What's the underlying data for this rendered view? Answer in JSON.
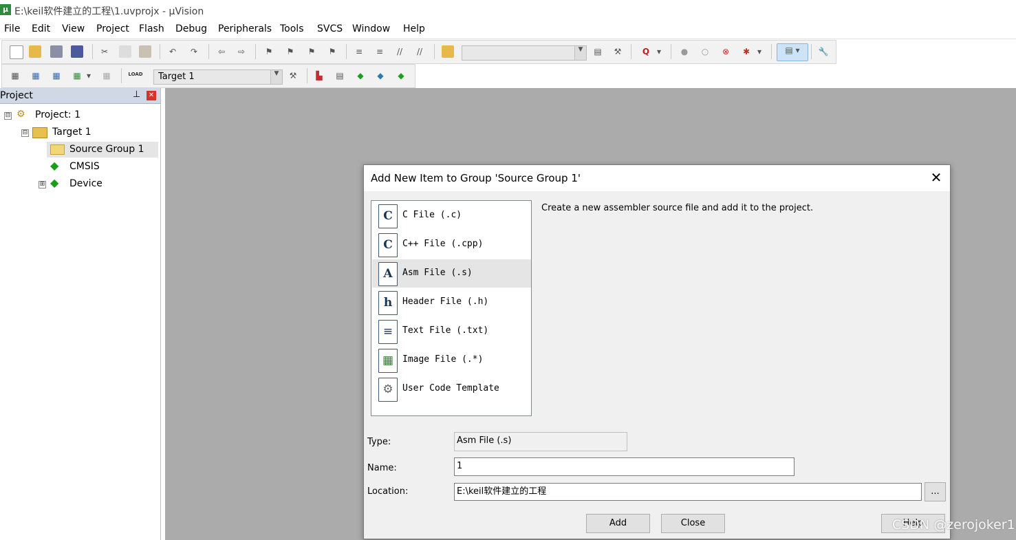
{
  "window": {
    "title": "E:\\keil软件建立的工程\\1.uvprojx - µVision",
    "app_icon": "uvision-icon"
  },
  "menu": [
    "File",
    "Edit",
    "View",
    "Project",
    "Flash",
    "Debug",
    "Peripherals",
    "Tools",
    "SVCS",
    "Window",
    "Help"
  ],
  "toolbar": {
    "target_value": "Target 1",
    "load_label": "LOAD"
  },
  "project_panel": {
    "title": "Project",
    "tree": [
      {
        "label": "Project: 1",
        "expander": "⊟"
      },
      {
        "label": "Target 1",
        "expander": "⊟"
      },
      {
        "label": "Source Group 1",
        "expander": ""
      },
      {
        "label": "CMSIS",
        "expander": ""
      },
      {
        "label": "Device",
        "expander": "⊞"
      }
    ]
  },
  "dialog": {
    "title": "Add New Item to Group 'Source Group 1'",
    "close_glyph": "✕",
    "description": "Create a new assembler source file and add it to the project.",
    "items": [
      {
        "icon_letter": "C",
        "label": "C File (.c)"
      },
      {
        "icon_letter": "C",
        "label": "C++ File (.cpp)"
      },
      {
        "icon_letter": "A",
        "label": "Asm File (.s)"
      },
      {
        "icon_letter": "h",
        "label": "Header File (.h)"
      },
      {
        "icon_letter": "≡",
        "label": "Text File (.txt)"
      },
      {
        "icon_letter": "▦",
        "label": "Image File (.*)"
      },
      {
        "icon_letter": "⚙",
        "label": "User Code Template"
      }
    ],
    "selected_index": 2,
    "type_label": "Type:",
    "type_value": "Asm File (.s)",
    "name_label": "Name:",
    "name_value": "1",
    "location_label": "Location:",
    "location_value": "E:\\keil软件建立的工程",
    "browse_label": "...",
    "add_label": "Add",
    "close_label": "Close",
    "help_label": "Help"
  },
  "watermark": "CSDN @zerojoker1",
  "colors": {
    "workspace": "#ababab",
    "panel_header": "#cfd8e4",
    "dialog_bg": "#f0f0f0",
    "selected_row": "#e5e5e5"
  }
}
